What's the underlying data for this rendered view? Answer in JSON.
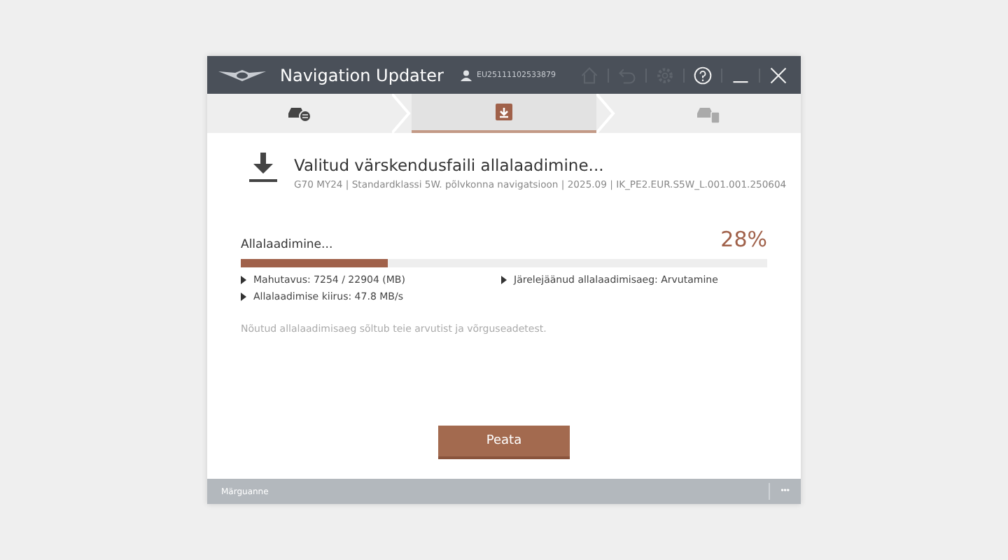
{
  "window": {
    "title": "Navigation Updater",
    "user_id": "EU25111102533879"
  },
  "toolbar": [
    {
      "kind": "home",
      "disabled": true
    },
    {
      "kind": "back",
      "disabled": true
    },
    {
      "kind": "settings",
      "disabled": true
    },
    {
      "kind": "help",
      "disabled": false
    },
    {
      "kind": "minimize",
      "disabled": false
    },
    {
      "kind": "close",
      "disabled": false
    }
  ],
  "steps": [
    {
      "kind": "car",
      "selected": false
    },
    {
      "kind": "download",
      "selected": true
    },
    {
      "kind": "install",
      "selected": false
    }
  ],
  "download": {
    "title": "Valitud värskendusfaili allalaadimine...",
    "subtitle": "G70 MY24 | Standardklassi 5W. põlvkonna navigatsioon | 2025.09 | IK_PE2.EUR.S5W_L.001.001.250604"
  },
  "progress": {
    "label": "Allalaadimine...",
    "percent": "28%",
    "level": 0.28
  },
  "details": [
    "Mahutavus: 7254 / 22904 (MB)",
    "Järelejäänud allalaadimisaeg: Arvutamine",
    "Allalaadimise kiirus: 47.8 MB/s"
  ],
  "note": "Nõutud allalaadimisaeg sõltub teie arvutist ja võrguseadetest.",
  "buttons": [
    "Peata"
  ],
  "status_bar": {
    "text": "Märguanne",
    "more": "•••"
  }
}
